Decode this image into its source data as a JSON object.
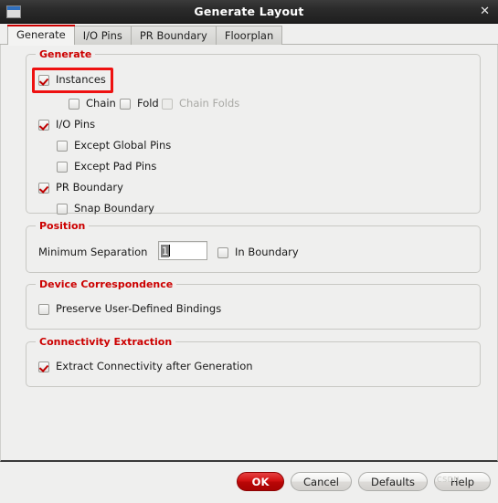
{
  "window": {
    "title": "Generate Layout",
    "icon": "window-icon",
    "close_label": "✕"
  },
  "tabs": [
    {
      "label": "Generate",
      "active": true
    },
    {
      "label": "I/O Pins",
      "active": false
    },
    {
      "label": "PR Boundary",
      "active": false
    },
    {
      "label": "Floorplan",
      "active": false
    }
  ],
  "groups": {
    "generate": {
      "legend": "Generate",
      "items": [
        {
          "label": "Instances",
          "checked": true,
          "disabled": false,
          "highlighted": true
        },
        {
          "label": "Chain",
          "checked": false,
          "disabled": false
        },
        {
          "label": "Fold",
          "checked": false,
          "disabled": false
        },
        {
          "label": "Chain Folds",
          "checked": false,
          "disabled": true
        },
        {
          "label": "I/O Pins",
          "checked": true,
          "disabled": false
        },
        {
          "label": "Except Global Pins",
          "checked": false,
          "disabled": false
        },
        {
          "label": "Except Pad Pins",
          "checked": false,
          "disabled": false
        },
        {
          "label": "PR Boundary",
          "checked": true,
          "disabled": false
        },
        {
          "label": "Snap Boundary",
          "checked": false,
          "disabled": false
        }
      ]
    },
    "position": {
      "legend": "Position",
      "separation_label": "Minimum Separation",
      "separation_value": "1",
      "in_boundary": {
        "label": "In Boundary",
        "checked": false
      }
    },
    "device_correspondence": {
      "legend": "Device Correspondence",
      "preserve": {
        "label": "Preserve User-Defined Bindings",
        "checked": false
      }
    },
    "connectivity_extraction": {
      "legend": "Connectivity Extraction",
      "extract": {
        "label": "Extract Connectivity after Generation",
        "checked": true
      }
    }
  },
  "buttons": {
    "ok": "OK",
    "cancel": "Cancel",
    "defaults": "Defaults",
    "help": "Help",
    "help_watermark": "CSDN"
  },
  "colors": {
    "accent_red": "#cc0000",
    "highlight_red": "#ee1111",
    "panel_bg": "#efefee",
    "titlebar": "#2c2c2c"
  }
}
